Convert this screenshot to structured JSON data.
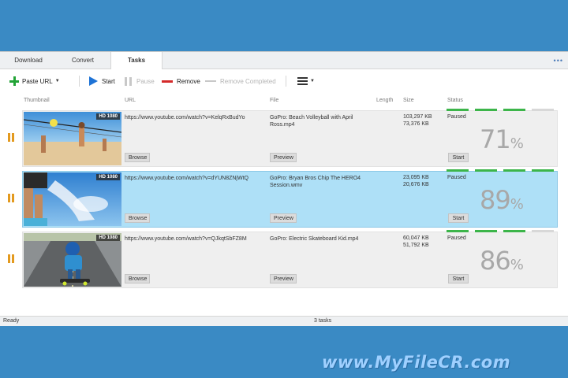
{
  "tabs": [
    {
      "label": "Download"
    },
    {
      "label": "Convert"
    },
    {
      "label": "Tasks"
    }
  ],
  "menu_dots": "•••",
  "toolbar": {
    "paste_url": "Paste URL",
    "start": "Start",
    "pause": "Pause",
    "remove": "Remove",
    "remove_completed": "Remove Completed"
  },
  "columns": {
    "thumbnail": "Thumbnail",
    "url": "URL",
    "file": "File",
    "length": "Length",
    "size": "Size",
    "status": "Status"
  },
  "rows": [
    {
      "hd": "HD 1080",
      "url": "https://www.youtube.com/watch?v=KelqRxBudYo",
      "file": "GoPro: Beach Volleyball with April Ross.mp4",
      "size_downloaded": "103,297 KB",
      "size_total": "73,376 KB",
      "status": "Paused",
      "browse": "Browse",
      "preview": "Preview",
      "start": "Start",
      "percent": "71",
      "percent_sign": "%",
      "progress": 0.71
    },
    {
      "hd": "HD 1080",
      "url": "https://www.youtube.com/watch?v=dYUN8ZNjWtQ",
      "file": "GoPro: Bryan Bros Chip The HERO4 Session.wmv",
      "size_downloaded": "23,095 KB",
      "size_total": "20,676 KB",
      "status": "Paused",
      "browse": "Browse",
      "preview": "Preview",
      "start": "Start",
      "percent": "89",
      "percent_sign": "%",
      "progress": 0.89
    },
    {
      "hd": "HD 1080",
      "url": "https://www.youtube.com/watch?v=QJkqtSbFZ8M",
      "file": "GoPro: Electric Skateboard Kid.mp4",
      "size_downloaded": "60,047 KB",
      "size_total": "51,792 KB",
      "status": "Paused",
      "browse": "Browse",
      "preview": "Preview",
      "start": "Start",
      "percent": "86",
      "percent_sign": "%",
      "progress": 0.86
    }
  ],
  "statusbar": {
    "left": "Ready",
    "center": "3 tasks"
  },
  "watermark": "www.MyFileCR.com",
  "colors": {
    "frame_blue": "#3a8ac4",
    "selected_row": "#aee0f7",
    "progress_green": "#3cb54a",
    "pause_orange": "#e39a1f"
  }
}
